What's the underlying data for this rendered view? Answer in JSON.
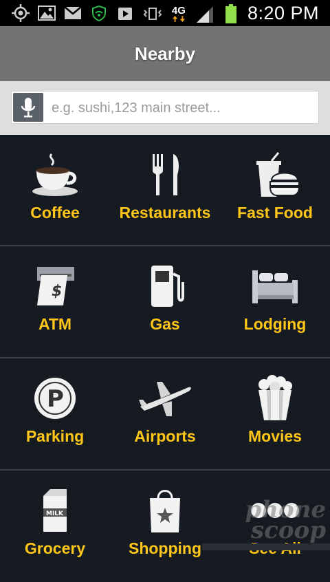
{
  "status_bar": {
    "time": "8:20 PM",
    "network": "4G"
  },
  "header": {
    "title": "Nearby"
  },
  "search": {
    "placeholder": "e.g. sushi,123 main street..."
  },
  "categories": [
    {
      "label": "Coffee",
      "icon": "coffee-cup-icon"
    },
    {
      "label": "Restaurants",
      "icon": "fork-knife-icon"
    },
    {
      "label": "Fast Food",
      "icon": "fast-food-icon"
    },
    {
      "label": "ATM",
      "icon": "atm-icon"
    },
    {
      "label": "Gas",
      "icon": "gas-pump-icon"
    },
    {
      "label": "Lodging",
      "icon": "bed-icon"
    },
    {
      "label": "Parking",
      "icon": "parking-icon"
    },
    {
      "label": "Airports",
      "icon": "airplane-icon"
    },
    {
      "label": "Movies",
      "icon": "popcorn-icon"
    },
    {
      "label": "Grocery",
      "icon": "milk-carton-icon"
    },
    {
      "label": "Shopping",
      "icon": "shopping-bag-icon"
    },
    {
      "label": "See All",
      "icon": "more-dots-icon"
    }
  ],
  "watermark": {
    "line1": "phone",
    "line2": "scoop"
  },
  "colors": {
    "accent": "#ffc61a",
    "background": "#161b22"
  }
}
